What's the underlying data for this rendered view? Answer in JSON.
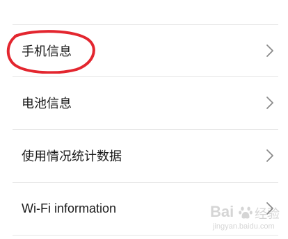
{
  "settings_list": {
    "items": [
      {
        "label": "手机信息"
      },
      {
        "label": "电池信息"
      },
      {
        "label": "使用情况统计数据"
      },
      {
        "label": "Wi-Fi information"
      }
    ]
  },
  "annotation": {
    "circle_color": "#e3262f"
  },
  "watermark": {
    "brand": "Bai",
    "brand_suffix": "经验",
    "url": "jingyan.baidu.com"
  },
  "icons": {
    "chevron": "chevron-right-icon",
    "paw": "baidu-paw-icon"
  }
}
